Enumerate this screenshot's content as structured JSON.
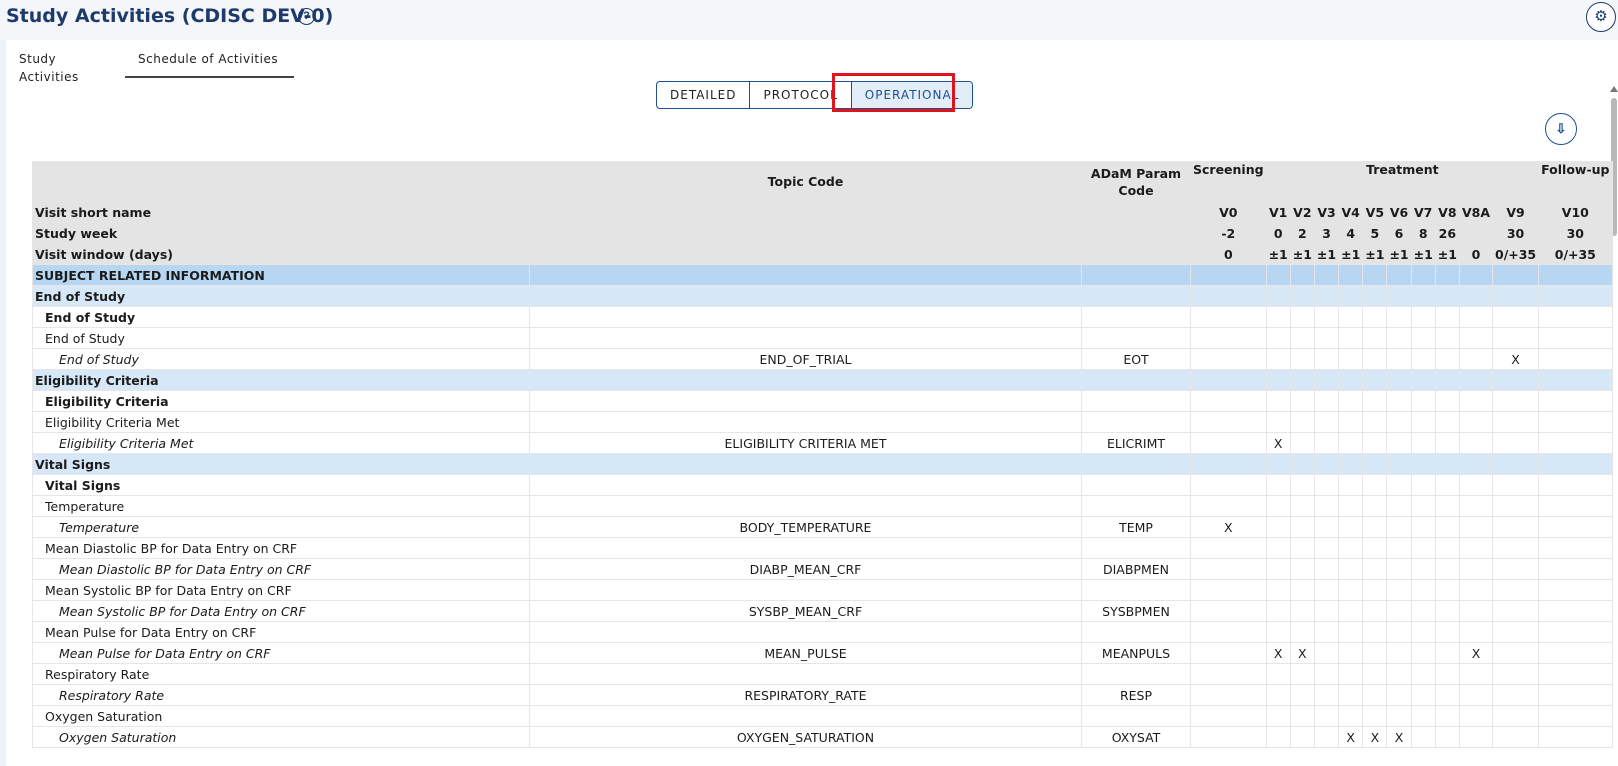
{
  "header": {
    "title": "Study Activities (CDISC DEV-0)",
    "help_icon": "?",
    "settings_icon": "⚙"
  },
  "tabs": [
    {
      "label": "Study Activities"
    },
    {
      "label": "Schedule of Activities",
      "active": true
    }
  ],
  "layout_toggle": [
    {
      "label": "DETAILED"
    },
    {
      "label": "PROTOCOL"
    },
    {
      "label": "OPERATIONAL",
      "active": true
    }
  ],
  "download_icon": "⇩",
  "table": {
    "col_topic": "Topic Code",
    "col_adam": "ADaM Param Code",
    "epochs": [
      {
        "label": "Screening",
        "span": 1
      },
      {
        "label": "Treatment",
        "span": 10
      },
      {
        "label": "Follow-up",
        "span": 2
      }
    ],
    "visit_row_label": "Visit short name",
    "week_row_label": "Study week",
    "window_row_label": "Visit window (days)",
    "visits": [
      "V0",
      "V1",
      "V2",
      "V3",
      "V4",
      "V5",
      "V6",
      "V7",
      "V8",
      "V8A",
      "V9",
      "V10"
    ],
    "weeks": [
      "-2",
      "0",
      "2",
      "3",
      "4",
      "5",
      "6",
      "8",
      "26",
      "",
      "30",
      "30"
    ],
    "windows": [
      "0",
      "±1",
      "±1",
      "±1",
      "±1",
      "±1",
      "±1",
      "±1",
      "±1",
      "0",
      "0/+35",
      "0/+35"
    ],
    "rows": [
      {
        "type": "soa-group",
        "label": "SUBJECT RELATED INFORMATION"
      },
      {
        "type": "group",
        "label": "End of Study"
      },
      {
        "type": "subgroup",
        "label": "End of Study"
      },
      {
        "type": "activity",
        "label": "End of Study"
      },
      {
        "type": "instance",
        "label": "End of Study",
        "topic": "END_OF_TRIAL",
        "adam": "EOT",
        "marks": [
          "",
          "",
          "",
          "",
          "",
          "",
          "",
          "",
          "",
          "",
          "X",
          ""
        ]
      },
      {
        "type": "group",
        "label": "Eligibility Criteria"
      },
      {
        "type": "subgroup",
        "label": "Eligibility Criteria"
      },
      {
        "type": "activity",
        "label": "Eligibility Criteria Met"
      },
      {
        "type": "instance",
        "label": "Eligibility Criteria Met",
        "topic": "ELIGIBILITY CRITERIA MET",
        "adam": "ELICRIMT",
        "marks": [
          "",
          "X",
          "",
          "",
          "",
          "",
          "",
          "",
          "",
          "",
          "",
          ""
        ]
      },
      {
        "type": "group",
        "label": "Vital Signs"
      },
      {
        "type": "subgroup",
        "label": "Vital Signs"
      },
      {
        "type": "activity",
        "label": "Temperature"
      },
      {
        "type": "instance",
        "label": "Temperature",
        "topic": "BODY_TEMPERATURE",
        "adam": "TEMP",
        "marks": [
          "X",
          "",
          "",
          "",
          "",
          "",
          "",
          "",
          "",
          "",
          "",
          ""
        ]
      },
      {
        "type": "activity",
        "label": "Mean Diastolic BP for Data Entry on CRF"
      },
      {
        "type": "instance",
        "label": "Mean Diastolic BP for Data Entry on CRF",
        "topic": "DIABP_MEAN_CRF",
        "adam": "DIABPMEN",
        "marks": [
          "",
          "",
          "",
          "",
          "",
          "",
          "",
          "",
          "",
          "",
          "",
          ""
        ]
      },
      {
        "type": "activity",
        "label": "Mean Systolic BP for Data Entry on CRF"
      },
      {
        "type": "instance",
        "label": "Mean Systolic BP for Data Entry on CRF",
        "topic": "SYSBP_MEAN_CRF",
        "adam": "SYSBPMEN",
        "marks": [
          "",
          "",
          "",
          "",
          "",
          "",
          "",
          "",
          "",
          "",
          "",
          ""
        ]
      },
      {
        "type": "activity",
        "label": "Mean Pulse for Data Entry on CRF"
      },
      {
        "type": "instance",
        "label": "Mean Pulse for Data Entry on CRF",
        "topic": "MEAN_PULSE",
        "adam": "MEANPULS",
        "marks": [
          "",
          "X",
          "X",
          "",
          "",
          "",
          "",
          "",
          "",
          "X",
          "",
          ""
        ]
      },
      {
        "type": "activity",
        "label": "Respiratory Rate"
      },
      {
        "type": "instance",
        "label": "Respiratory Rate",
        "topic": "RESPIRATORY_RATE",
        "adam": "RESP",
        "marks": [
          "",
          "",
          "",
          "",
          "",
          "",
          "",
          "",
          "",
          "",
          "",
          ""
        ]
      },
      {
        "type": "activity",
        "label": "Oxygen Saturation"
      },
      {
        "type": "instance",
        "label": "Oxygen Saturation",
        "topic": "OXYGEN_SATURATION",
        "adam": "OXYSAT",
        "marks": [
          "",
          "",
          "",
          "",
          "X",
          "X",
          "X",
          "",
          "",
          "",
          "",
          ""
        ]
      }
    ]
  }
}
